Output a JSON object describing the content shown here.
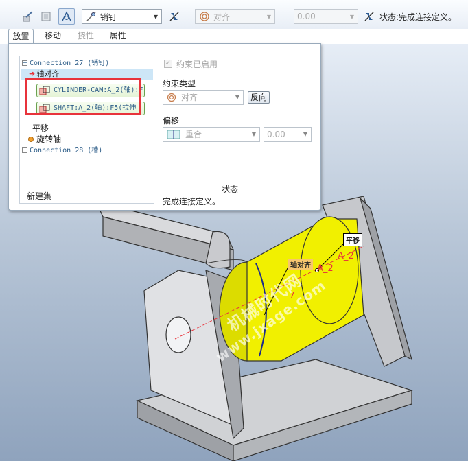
{
  "toolbar": {
    "connection_type": "销钉",
    "constraint_combo": "对齐",
    "offset_value": "0.00",
    "status": "状态:完成连接定义。"
  },
  "tabs": [
    {
      "label": "放置"
    },
    {
      "label": "移动"
    },
    {
      "label": "挠性"
    },
    {
      "label": "属性"
    }
  ],
  "tree": {
    "connection1": "Connection_27 (销钉)",
    "axis_align": "轴对齐",
    "ref1": "CYLINDER-CAM:A_2(轴):F",
    "ref2": "SHAFT:A_2(轴):F5(拉伸",
    "translate": "平移",
    "rotation_axis": "旋转轴",
    "connection2": "Connection_28 (槽)",
    "new_set": "新建集"
  },
  "settings": {
    "enabled_label": "约束已启用",
    "constraint_type_label": "约束类型",
    "constraint_type_value": "对齐",
    "flip_button": "反向",
    "offset_label": "偏移",
    "offset_type_value": "重合",
    "offset_value": "0.00",
    "status_label": "状态",
    "status_text": "完成连接定义。"
  },
  "viewport": {
    "callout_translate": "平移",
    "callout_axis_align": "轴对齐",
    "axis_label": "A_2",
    "axis_label_2": "A_2",
    "watermark_line1": "www.jxage.com",
    "watermark_line2": "机械时代网"
  },
  "colors": {
    "part_yellow": "#f1f000",
    "part_gray": "#b5b7bb",
    "highlight_red": "#e8333b",
    "accent_blue": "#2d5d88"
  }
}
